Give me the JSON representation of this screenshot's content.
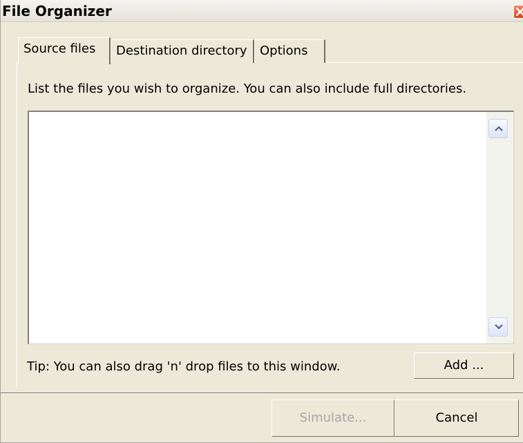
{
  "window": {
    "title": "File Organizer"
  },
  "tabs": [
    {
      "label": "Source files",
      "active": true
    },
    {
      "label": "Destination directory",
      "active": false
    },
    {
      "label": "Options",
      "active": false
    }
  ],
  "source_files": {
    "instructions": "List the files you wish to organize. You can also include full directories.",
    "file_list": [],
    "tip": "Tip: You can also drag 'n' drop files to this window.",
    "add_label": "Add ..."
  },
  "footer": {
    "simulate_label": "Simulate...",
    "simulate_enabled": false,
    "cancel_label": "Cancel"
  },
  "icons": {
    "close": "close-icon",
    "scroll_up": "chevron-up-icon",
    "scroll_down": "chevron-down-icon"
  },
  "colors": {
    "window_bg": "#ece9d8",
    "close_button": "#d6431c",
    "disabled_text": "#a7a6aa"
  }
}
